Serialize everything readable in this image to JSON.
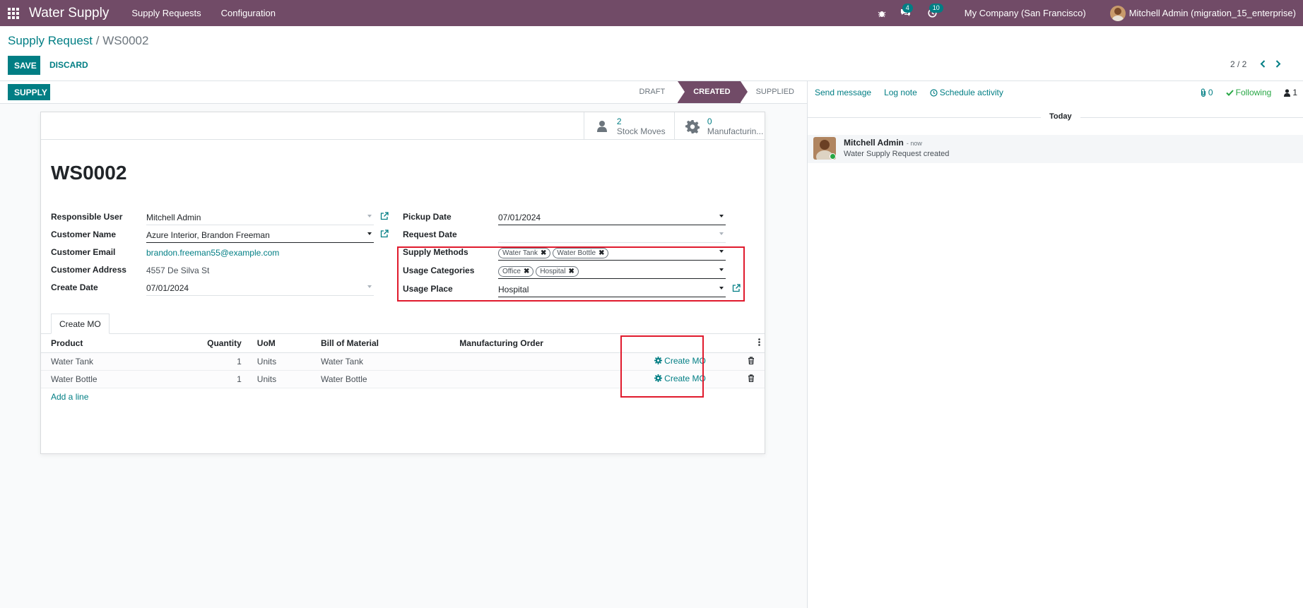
{
  "navbar": {
    "app_name": "Water Supply",
    "menus": [
      "Supply Requests",
      "Configuration"
    ],
    "messages_badge": "4",
    "activities_badge": "10",
    "company": "My Company (San Francisco)",
    "user": "Mitchell Admin (migration_15_enterprise)"
  },
  "breadcrumb": {
    "parent": "Supply Request",
    "separator": "/",
    "current": "WS0002"
  },
  "actions": {
    "save": "SAVE",
    "discard": "DISCARD"
  },
  "pager": {
    "value": "2 / 2"
  },
  "statusbar": {
    "supply_button": "SUPPLY",
    "stages": [
      "DRAFT",
      "CREATED",
      "SUPPLIED"
    ],
    "active_stage": "CREATED"
  },
  "smart_buttons": {
    "stock_moves": {
      "value": "2",
      "label": "Stock Moves"
    },
    "manufacturing": {
      "value": "0",
      "label": "Manufacturin..."
    }
  },
  "record": {
    "name": "WS0002",
    "left_fields": [
      {
        "label": "Responsible User",
        "value": "Mitchell Admin"
      },
      {
        "label": "Customer Name",
        "value": "Azure Interior, Brandon Freeman"
      },
      {
        "label": "Customer Email",
        "value": "brandon.freeman55@example.com"
      },
      {
        "label": "Customer Address",
        "value": "4557 De Silva St"
      },
      {
        "label": "Create Date",
        "value": "07/01/2024"
      }
    ],
    "right_fields": [
      {
        "label": "Pickup Date",
        "value": "07/01/2024"
      },
      {
        "label": "Request Date",
        "value": ""
      },
      {
        "label": "Supply Methods",
        "tags": [
          "Water Tank",
          "Water Bottle"
        ]
      },
      {
        "label": "Usage Categories",
        "tags": [
          "Office",
          "Hospital"
        ]
      },
      {
        "label": "Usage Place",
        "value": "Hospital"
      }
    ]
  },
  "notebook": {
    "tab": "Create MO",
    "columns": [
      "Product",
      "Quantity",
      "UoM",
      "Bill of Material",
      "Manufacturing Order"
    ],
    "rows": [
      {
        "product": "Water Tank",
        "quantity": "1",
        "uom": "Units",
        "bom": "Water Tank",
        "mo": "",
        "action": "Create MO"
      },
      {
        "product": "Water Bottle",
        "quantity": "1",
        "uom": "Units",
        "bom": "Water Bottle",
        "mo": "",
        "action": "Create MO"
      }
    ],
    "add_line": "Add a line"
  },
  "chatter": {
    "send_message": "Send message",
    "log_note": "Log note",
    "schedule_activity": "Schedule activity",
    "attachments": "0",
    "following": "Following",
    "followers": "1",
    "date_separator": "Today",
    "message": {
      "author": "Mitchell Admin",
      "date": "- now",
      "body": "Water Supply Request created"
    }
  },
  "colors": {
    "brand": "#714b67",
    "primary": "#017e84",
    "highlight": "#e01a2d"
  }
}
